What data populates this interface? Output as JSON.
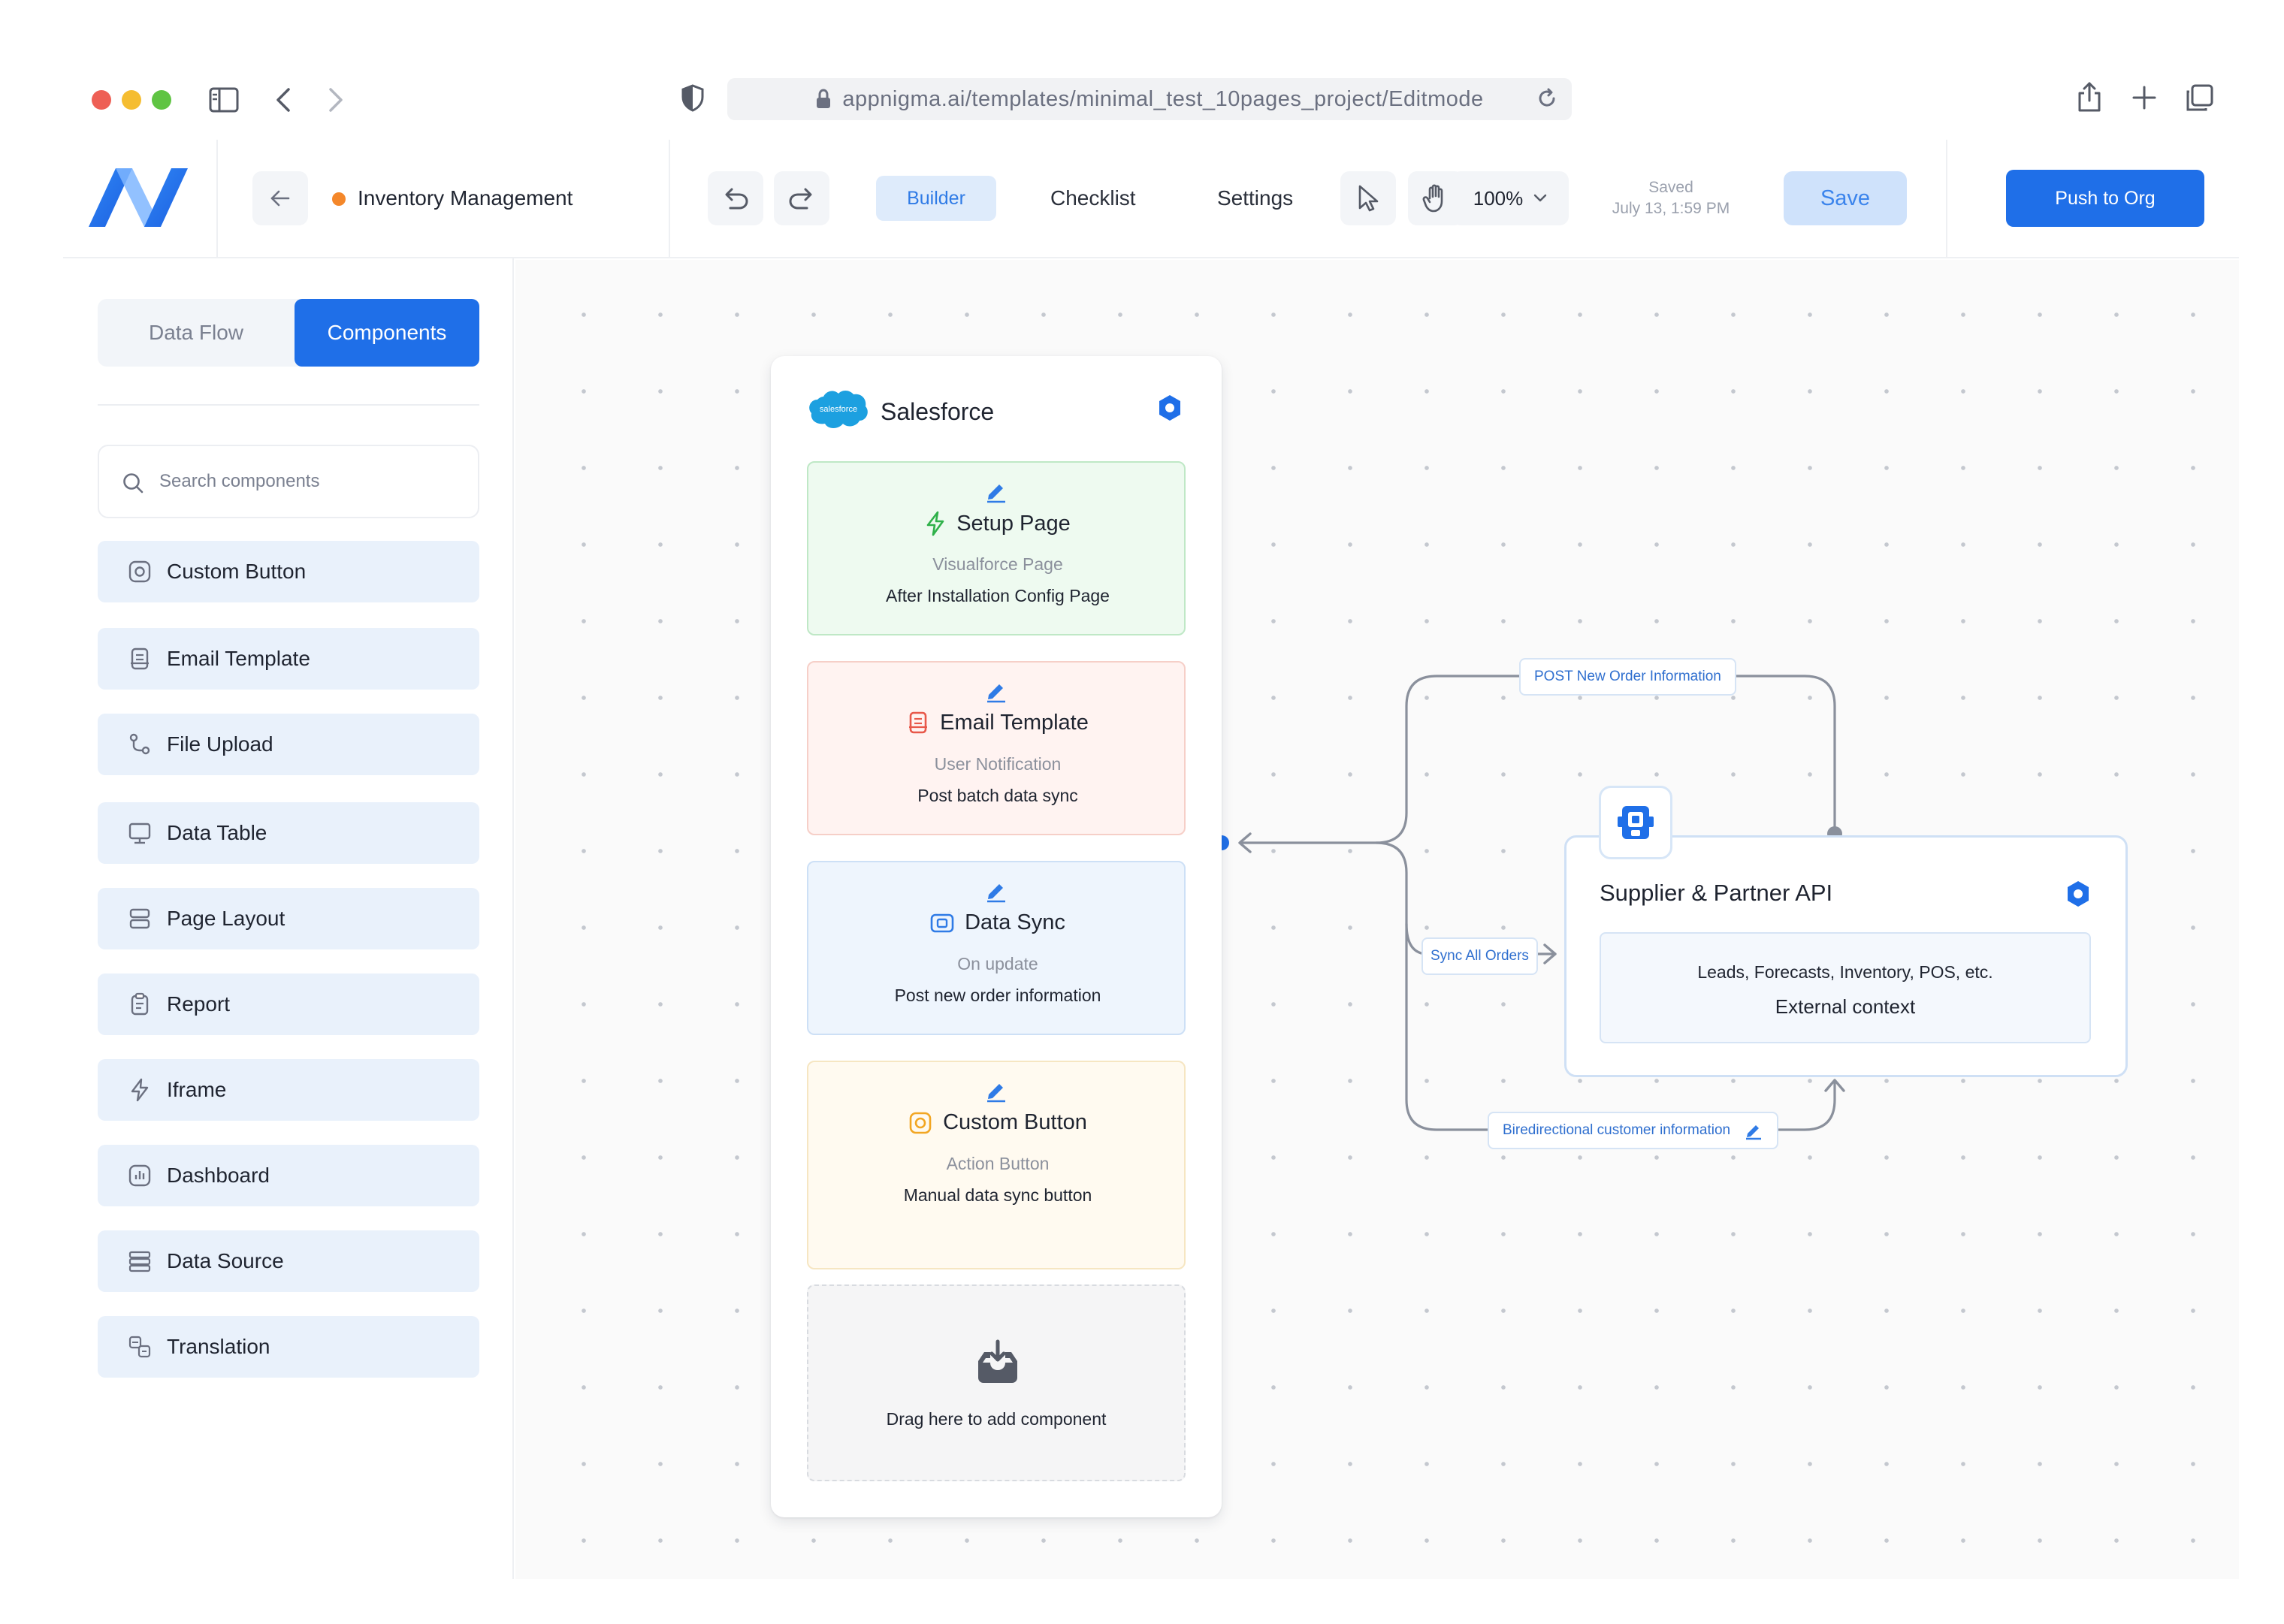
{
  "browser": {
    "url": "appnigma.ai/templates/minimal_test_10pages_project/Editmode"
  },
  "header": {
    "project_name": "Inventory Management",
    "tabs": {
      "builder": "Builder",
      "checklist": "Checklist",
      "settings": "Settings"
    },
    "zoom": "100%",
    "saved_label": "Saved",
    "saved_time": "July 13, 1:59 PM",
    "save_label": "Save",
    "push_label": "Push to Org",
    "project_status_color": "#f4872a",
    "accent_color": "#1f6fe8"
  },
  "sidebar": {
    "tabs": {
      "data_flow": "Data Flow",
      "components": "Components"
    },
    "search_placeholder": "Search components",
    "items": [
      {
        "label": "Custom Button",
        "icon": "custom-button-icon"
      },
      {
        "label": "Email Template",
        "icon": "email-template-icon"
      },
      {
        "label": "File Upload",
        "icon": "file-upload-icon"
      },
      {
        "label": "Data Table",
        "icon": "data-table-icon"
      },
      {
        "label": "Page Layout",
        "icon": "page-layout-icon"
      },
      {
        "label": "Report",
        "icon": "report-icon"
      },
      {
        "label": "Iframe",
        "icon": "iframe-icon"
      },
      {
        "label": "Dashboard",
        "icon": "dashboard-icon"
      },
      {
        "label": "Data Source",
        "icon": "data-source-icon"
      },
      {
        "label": "Translation",
        "icon": "translation-icon"
      }
    ]
  },
  "canvas": {
    "salesforce": {
      "title": "Salesforce",
      "logo_text": "salesforce",
      "components": [
        {
          "title": "Setup Page",
          "subtitle": "Visualforce Page",
          "description": "After Installation Config Page",
          "icon": "lightning-icon",
          "bg": "#eefaf0",
          "border": "#bfe8c6"
        },
        {
          "title": "Email Template",
          "subtitle": "User Notification",
          "description": "Post batch data sync",
          "icon": "email-template-icon",
          "bg": "#fff3f1",
          "border": "#f6cfc8"
        },
        {
          "title": "Data Sync",
          "subtitle": "On update",
          "description": "Post new order information",
          "icon": "data-sync-icon",
          "bg": "#eef5fd",
          "border": "#cde0f6"
        },
        {
          "title": "Custom Button",
          "subtitle": "Action Button",
          "description": "Manual data sync button",
          "icon": "custom-button-icon",
          "bg": "#fffaf0",
          "border": "#f6e6c2"
        }
      ],
      "drop_text": "Drag here to add component"
    },
    "connections": {
      "post_new_order": "POST New Order Information",
      "sync_all_orders": "Sync All Orders",
      "bidirectional": "Biredirectional customer information"
    },
    "supplier": {
      "title": "Supplier & Partner API",
      "context_line1": "Leads, Forecasts, Inventory, POS, etc.",
      "context_line2": "External context"
    }
  }
}
